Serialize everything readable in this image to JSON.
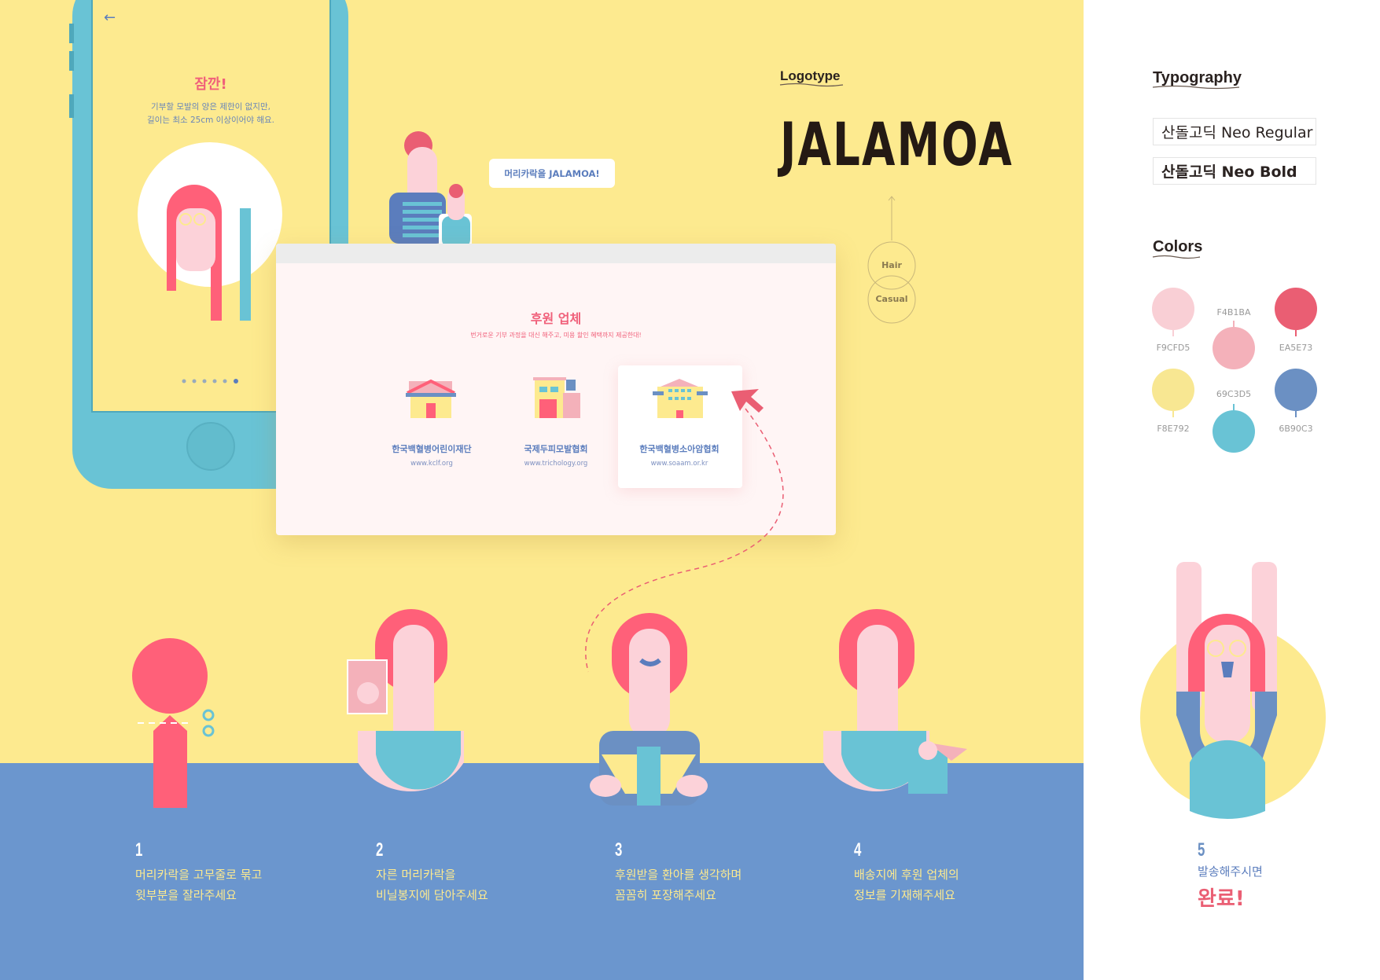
{
  "phone": {
    "title": "잠깐!",
    "line1": "기부할 모발의 양은 제한이 없지만,",
    "line2": "길이는 최소 25cm 이상이어야 해요.",
    "page_count": 6,
    "active_page": 6
  },
  "bubble": "머리카락을 JALAMOA!",
  "sponsors": {
    "title": "후원 업체",
    "subtitle": "번거로운 기부 과정을 대신 해주고, 미용 할인 혜택까지 제공한대!",
    "orgs": [
      {
        "name": "한국백혈병어린이재단",
        "url": "www.kclf.org"
      },
      {
        "name": "국제두피모발협회",
        "url": "www.trichology.org"
      },
      {
        "name": "한국백혈병소아암협회",
        "url": "www.soaam.or.kr"
      }
    ]
  },
  "logotype": {
    "label": "Logotype",
    "logo": "JALAMOA",
    "keywords": [
      "Hair",
      "Casual"
    ]
  },
  "typography": {
    "label": "Typography",
    "fonts": [
      "산돌고딕 Neo Regular",
      "산돌고딕 Neo Bold"
    ]
  },
  "colors": {
    "label": "Colors",
    "swatches": [
      "F9CFD5",
      "F4B1BA",
      "EA5E73",
      "F8E792",
      "69C3D5",
      "6B90C3"
    ]
  },
  "steps": [
    {
      "num": "1",
      "line1": "머리카락을 고무줄로 묶고",
      "line2": "윗부분을 잘라주세요"
    },
    {
      "num": "2",
      "line1": "자른 머리카락을",
      "line2": "비닐봉지에 담아주세요"
    },
    {
      "num": "3",
      "line1": "후원받을 환아를 생각하며",
      "line2": "꼼꼼히 포장해주세요"
    },
    {
      "num": "4",
      "line1": "배송지에 후원 업체의",
      "line2": "정보를 기재해주세요"
    }
  ],
  "final_step": {
    "num": "5",
    "line1": "발송해주시면",
    "line2": "완료!"
  }
}
